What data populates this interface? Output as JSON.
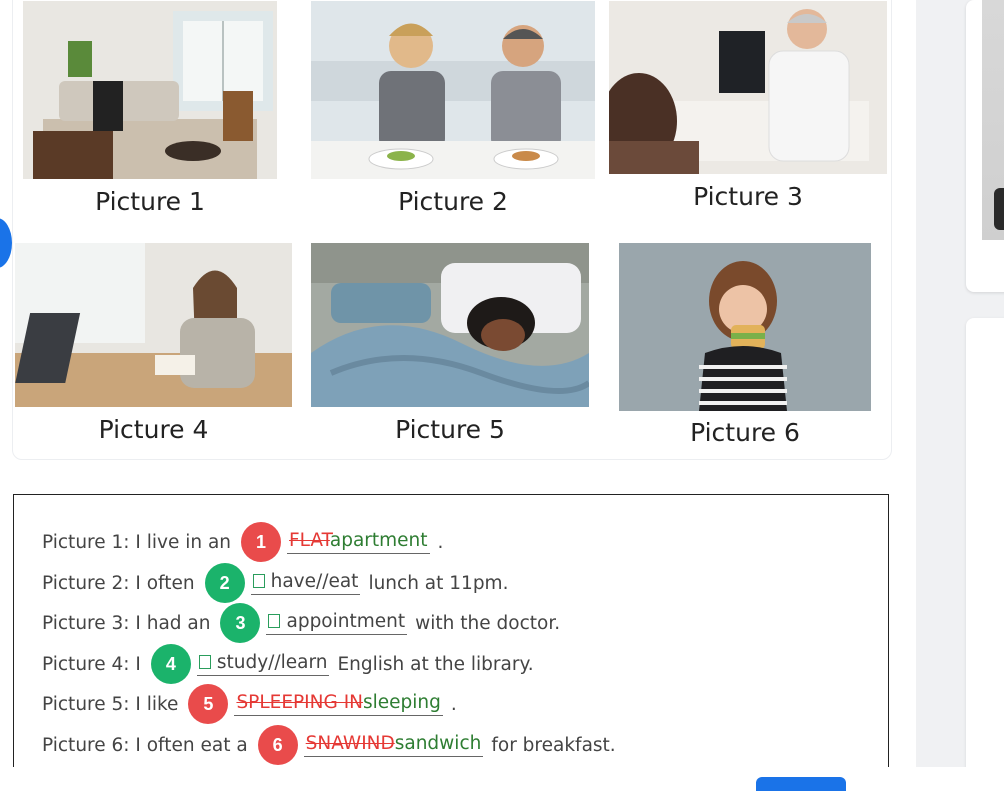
{
  "pictures": [
    {
      "caption": "Picture 1",
      "scene": "living-room"
    },
    {
      "caption": "Picture 2",
      "scene": "business-lunch"
    },
    {
      "caption": "Picture 3",
      "scene": "doctor-appointment"
    },
    {
      "caption": "Picture 4",
      "scene": "student-studying"
    },
    {
      "caption": "Picture 5",
      "scene": "woman-sleeping"
    },
    {
      "caption": "Picture 6",
      "scene": "girl-eating-sandwich"
    }
  ],
  "exercise": {
    "lines": [
      {
        "prefix": "Picture 1: I live in an",
        "number": "1",
        "status": "wrong",
        "wrong": "FLAT",
        "correct": "apartment",
        "suffix": "."
      },
      {
        "prefix": "Picture 2: I often",
        "number": "2",
        "status": "right",
        "answer": "have//eat",
        "suffix": "lunch at 11pm."
      },
      {
        "prefix": "Picture 3: I had an",
        "number": "3",
        "status": "right",
        "answer": "appointment",
        "suffix": "with the doctor."
      },
      {
        "prefix": "Picture 4: I",
        "number": "4",
        "status": "right",
        "answer": "study//learn",
        "suffix": "English at the library."
      },
      {
        "prefix": "Picture 5: I like",
        "number": "5",
        "status": "wrong",
        "wrong": "SPLEEPING IN",
        "correct": "sleeping",
        "suffix": "."
      },
      {
        "prefix": "Picture 6: I often eat a",
        "number": "6",
        "status": "wrong",
        "wrong": "SNAWIND",
        "correct": "sandwich",
        "suffix": "for breakfast."
      }
    ]
  },
  "colors": {
    "wrong_badge": "#e94b4b",
    "right_badge": "#1bb36b",
    "strike_text": "#e53935",
    "correct_text": "#2e7d32",
    "primary_button": "#1a73e8"
  }
}
